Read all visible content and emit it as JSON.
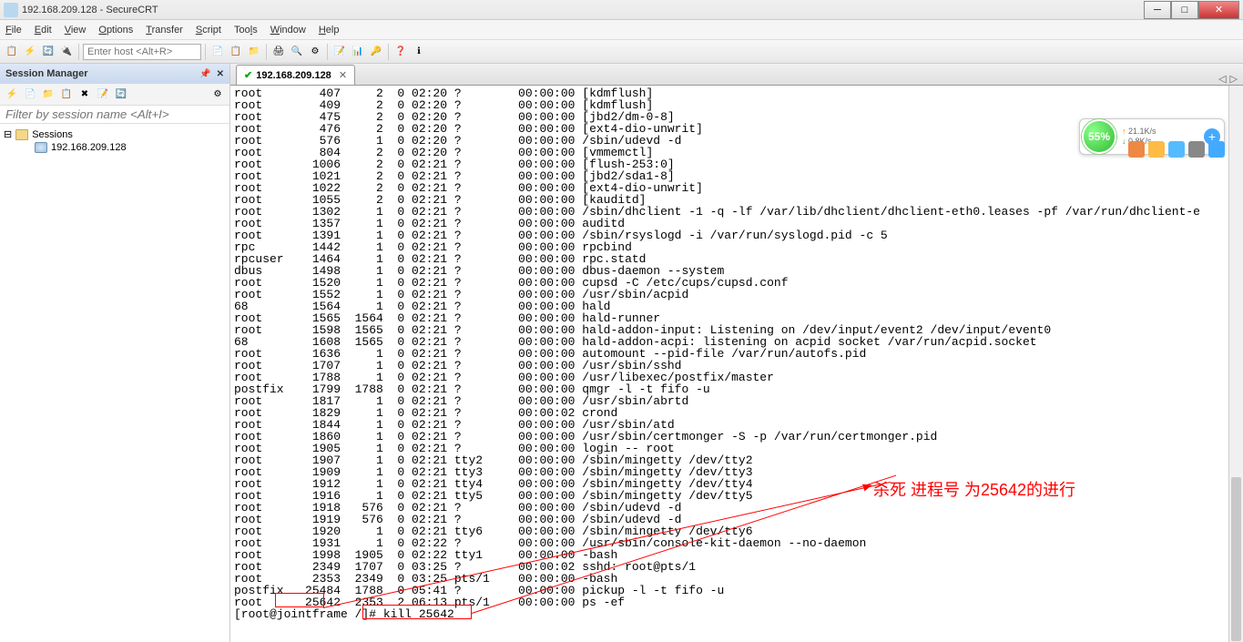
{
  "window": {
    "title": "192.168.209.128 - SecureCRT",
    "min": "─",
    "max": "□",
    "close": "✕"
  },
  "menu": {
    "file": "File",
    "edit": "Edit",
    "view": "View",
    "options": "Options",
    "transfer": "Transfer",
    "script": "Script",
    "tools": "Tools",
    "window": "Window",
    "help": "Help"
  },
  "toolbar": {
    "host_placeholder": "Enter host <Alt+R>"
  },
  "sidebar": {
    "title": "Session Manager",
    "filter_placeholder": "Filter by session name <Alt+I>",
    "root": "Sessions",
    "session1": "192.168.209.128"
  },
  "tab": {
    "label": "192.168.209.128",
    "check": "✔",
    "close": "✕"
  },
  "terminal_lines": [
    "root        407     2  0 02:20 ?        00:00:00 [kdmflush]",
    "root        409     2  0 02:20 ?        00:00:00 [kdmflush]",
    "root        475     2  0 02:20 ?        00:00:00 [jbd2/dm-0-8]",
    "root        476     2  0 02:20 ?        00:00:00 [ext4-dio-unwrit]",
    "root        576     1  0 02:20 ?        00:00:00 /sbin/udevd -d",
    "root        804     2  0 02:20 ?        00:00:00 [vmmemctl]",
    "root       1006     2  0 02:21 ?        00:00:00 [flush-253:0]",
    "root       1021     2  0 02:21 ?        00:00:00 [jbd2/sda1-8]",
    "root       1022     2  0 02:21 ?        00:00:00 [ext4-dio-unwrit]",
    "root       1055     2  0 02:21 ?        00:00:00 [kauditd]",
    "root       1302     1  0 02:21 ?        00:00:00 /sbin/dhclient -1 -q -lf /var/lib/dhclient/dhclient-eth0.leases -pf /var/run/dhclient-e",
    "root       1357     1  0 02:21 ?        00:00:00 auditd",
    "root       1391     1  0 02:21 ?        00:00:00 /sbin/rsyslogd -i /var/run/syslogd.pid -c 5",
    "rpc        1442     1  0 02:21 ?        00:00:00 rpcbind",
    "rpcuser    1464     1  0 02:21 ?        00:00:00 rpc.statd",
    "dbus       1498     1  0 02:21 ?        00:00:00 dbus-daemon --system",
    "root       1520     1  0 02:21 ?        00:00:00 cupsd -C /etc/cups/cupsd.conf",
    "root       1552     1  0 02:21 ?        00:00:00 /usr/sbin/acpid",
    "68         1564     1  0 02:21 ?        00:00:00 hald",
    "root       1565  1564  0 02:21 ?        00:00:00 hald-runner",
    "root       1598  1565  0 02:21 ?        00:00:00 hald-addon-input: Listening on /dev/input/event2 /dev/input/event0",
    "68         1608  1565  0 02:21 ?        00:00:00 hald-addon-acpi: listening on acpid socket /var/run/acpid.socket",
    "root       1636     1  0 02:21 ?        00:00:00 automount --pid-file /var/run/autofs.pid",
    "root       1707     1  0 02:21 ?        00:00:00 /usr/sbin/sshd",
    "root       1788     1  0 02:21 ?        00:00:00 /usr/libexec/postfix/master",
    "postfix    1799  1788  0 02:21 ?        00:00:00 qmgr -l -t fifo -u",
    "root       1817     1  0 02:21 ?        00:00:00 /usr/sbin/abrtd",
    "root       1829     1  0 02:21 ?        00:00:02 crond",
    "root       1844     1  0 02:21 ?        00:00:00 /usr/sbin/atd",
    "root       1860     1  0 02:21 ?        00:00:00 /usr/sbin/certmonger -S -p /var/run/certmonger.pid",
    "root       1905     1  0 02:21 ?        00:00:00 login -- root",
    "root       1907     1  0 02:21 tty2     00:00:00 /sbin/mingetty /dev/tty2",
    "root       1909     1  0 02:21 tty3     00:00:00 /sbin/mingetty /dev/tty3",
    "root       1912     1  0 02:21 tty4     00:00:00 /sbin/mingetty /dev/tty4",
    "root       1916     1  0 02:21 tty5     00:00:00 /sbin/mingetty /dev/tty5",
    "root       1918   576  0 02:21 ?        00:00:00 /sbin/udevd -d",
    "root       1919   576  0 02:21 ?        00:00:00 /sbin/udevd -d",
    "root       1920     1  0 02:21 tty6     00:00:00 /sbin/mingetty /dev/tty6",
    "root       1931     1  0 02:22 ?        00:00:00 /usr/sbin/console-kit-daemon --no-daemon",
    "root       1998  1905  0 02:22 tty1     00:00:00 -bash",
    "root       2349  1707  0 03:25 ?        00:00:02 sshd: root@pts/1",
    "root       2353  2349  0 03:25 pts/1    00:00:00 -bash",
    "postfix   25484  1788  0 05:41 ?        00:00:00 pickup -l -t fifo -u",
    "root      25642  2353  2 06:13 pts/1    00:00:00 ps -ef",
    "[root@jointframe /]# kill 25642"
  ],
  "annotation": {
    "text": "杀死 进程号 为25642的进行"
  },
  "widget": {
    "percent": "55%",
    "up": "21.1K/s",
    "down": "0.8K/s"
  }
}
